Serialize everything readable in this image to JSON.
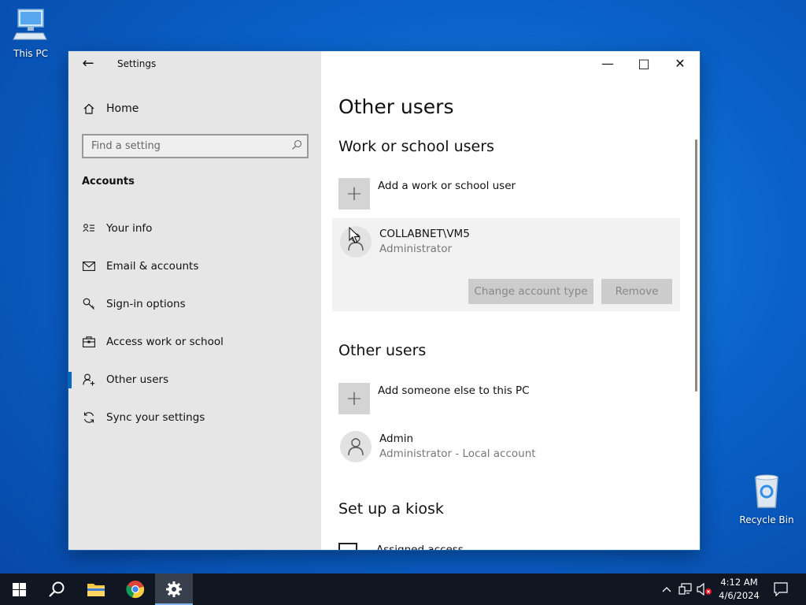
{
  "desktop": {
    "icons": [
      {
        "label": "This PC"
      },
      {
        "label": "Recycle Bin"
      }
    ]
  },
  "window": {
    "title": "Settings",
    "back_label": "←",
    "min_label": "—",
    "max_label": "□",
    "close_label": "✕"
  },
  "sidebar": {
    "home_label": "Home",
    "search_placeholder": "Find a setting",
    "section_label": "Accounts",
    "items": [
      {
        "label": "Your info",
        "icon": "contact-card-icon"
      },
      {
        "label": "Email & accounts",
        "icon": "mail-icon"
      },
      {
        "label": "Sign-in options",
        "icon": "key-icon"
      },
      {
        "label": "Access work or school",
        "icon": "briefcase-icon"
      },
      {
        "label": "Other users",
        "icon": "person-add-icon",
        "active": true
      },
      {
        "label": "Sync your settings",
        "icon": "sync-icon"
      }
    ]
  },
  "main": {
    "title": "Other users",
    "work_section": {
      "heading": "Work or school users",
      "add_label": "Add a work or school user",
      "add_symbol": "+",
      "user": {
        "name": "COLLABNET\\VM5",
        "role": "Administrator",
        "change_type_label": "Change account type",
        "remove_label": "Remove"
      }
    },
    "other_section": {
      "heading": "Other users",
      "add_label": "Add someone else to this PC",
      "add_symbol": "+",
      "user": {
        "name": "Admin",
        "role": "Administrator - Local account"
      }
    },
    "kiosk_section": {
      "heading": "Set up a kiosk",
      "item_label": "Assigned access"
    }
  },
  "taskbar": {
    "time": "4:12 AM",
    "date": "4/6/2024",
    "apps": [
      "start",
      "search",
      "file-explorer",
      "chrome",
      "settings"
    ]
  },
  "colors": {
    "accent": "#0067c0",
    "sidebar_bg": "#e6e6e6",
    "taskbar_bg": "#101622"
  }
}
